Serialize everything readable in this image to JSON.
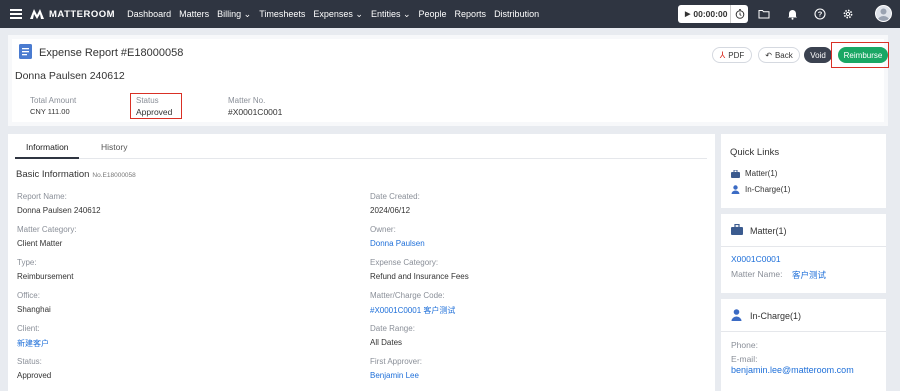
{
  "nav": {
    "brand": "MATTEROOM",
    "items": [
      "Dashboard",
      "Matters",
      "Billing ⌄",
      "Timesheets",
      "Expenses ⌄",
      "Entities ⌄",
      "People",
      "Reports",
      "Distribution"
    ],
    "timer": "00:00:00"
  },
  "header": {
    "title": "Expense Report #E18000058",
    "name": "Donna Paulsen 240612",
    "buttons": {
      "pdf": "PDF",
      "back": "Back",
      "void": "Void",
      "reimburse": "Reimburse"
    },
    "summary": {
      "total_label": "Total Amount",
      "total_value": "CNY 111.00",
      "status_label": "Status",
      "status_value": "Approved",
      "matter_label": "Matter No.",
      "matter_value": "#X0001C0001"
    }
  },
  "tabs": [
    "Information",
    "History"
  ],
  "basic": {
    "title": "Basic Information",
    "no": "No.E18000058",
    "fields": [
      {
        "label": "Report Name:",
        "value": "Donna Paulsen 240612",
        "link": false
      },
      {
        "label": "Date Created:",
        "value": "2024/06/12",
        "link": false
      },
      {
        "label": "Matter Category:",
        "value": "Client Matter",
        "link": false
      },
      {
        "label": "Owner:",
        "value": "Donna Paulsen",
        "link": true
      },
      {
        "label": "Type:",
        "value": "Reimbursement",
        "link": false
      },
      {
        "label": "Expense Category:",
        "value": "Refund and Insurance Fees",
        "link": false
      },
      {
        "label": "Office:",
        "value": "Shanghai",
        "link": false
      },
      {
        "label": "Matter/Charge Code:",
        "value": "#X0001C0001 客户测试",
        "link": true
      },
      {
        "label": "Client:",
        "value": "新建客户",
        "link": true
      },
      {
        "label": "Date Range:",
        "value": "All Dates",
        "link": false
      },
      {
        "label": "Status:",
        "value": "Approved",
        "link": false
      },
      {
        "label": "First Approver:",
        "value": "Benjamin Lee",
        "link": true
      }
    ]
  },
  "quick_links": {
    "title": "Quick Links",
    "items": [
      "Matter(1)",
      "In-Charge(1)"
    ]
  },
  "matter_panel": {
    "title": "Matter(1)",
    "code": "X0001C0001",
    "name_label": "Matter Name:",
    "name_value": "客户测试"
  },
  "incharge_panel": {
    "title": "In-Charge(1)",
    "phone_label": "Phone:",
    "email_label": "E-mail:",
    "email_value": "benjamin.lee@matteroom.com"
  },
  "colors": {
    "nav_bg": "#2f3541",
    "accent_green": "#1aa764",
    "link_blue": "#1e6fd9",
    "highlight_red": "#d93025",
    "void_dark": "#3b4250"
  }
}
